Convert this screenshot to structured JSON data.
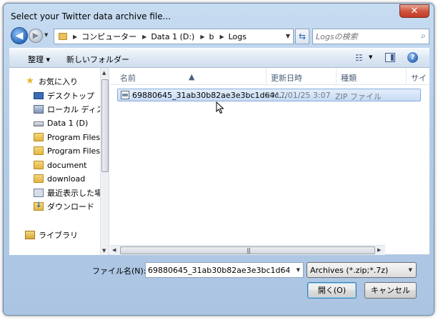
{
  "window": {
    "title": "Select your Twitter data archive file...",
    "close_glyph": "✕"
  },
  "address": {
    "back_glyph": "◀",
    "forward_glyph": "▶",
    "breadcrumbs": [
      "コンピューター",
      "Data 1 (D:)",
      "b",
      "Logs"
    ],
    "refresh_glyph": "⇆"
  },
  "search": {
    "placeholder": "Logsの検索",
    "icon": "search-icon"
  },
  "commandbar": {
    "organize_label": "整理 ▾",
    "newfolder_label": "新しいフォルダー",
    "view_glyph": "☷",
    "help_glyph": "?"
  },
  "nav": {
    "items": [
      {
        "label": "お気に入り",
        "icon": "star-icon"
      },
      {
        "label": "デスクトップ",
        "icon": "desktop-icon"
      },
      {
        "label": "ローカル ディス",
        "icon": "local-disk-icon"
      },
      {
        "label": "Data 1 (D)",
        "icon": "drive-icon"
      },
      {
        "label": "Program Files",
        "icon": "folder-icon"
      },
      {
        "label": "Program Files (",
        "icon": "folder-icon"
      },
      {
        "label": "document",
        "icon": "folder-icon"
      },
      {
        "label": "download",
        "icon": "folder-icon"
      },
      {
        "label": "最近表示した場所",
        "icon": "recent-icon"
      },
      {
        "label": "ダウンロード",
        "icon": "downloads-icon"
      },
      {
        "label": "ライブラリ",
        "icon": "library-icon"
      }
    ]
  },
  "columns": {
    "name": "名前",
    "modified": "更新日時",
    "type": "種類",
    "size": "サイ"
  },
  "files": [
    {
      "name": "69880645_31ab30b82ae3e3bc1d64c...",
      "modified": "2017/01/25 3:07",
      "type": "ZIP ファイル"
    }
  ],
  "bottom": {
    "filename_label": "ファイル名(N):",
    "filename_value": "69880645_31ab30b82ae3e3bc1d64cd0116",
    "filter_value": "Archives (*.zip;*.7z)",
    "open_label": "開く(O)",
    "cancel_label": "キャンセル"
  },
  "colors": {
    "accent": "#2a6cc0",
    "selection": "#c7dbf5",
    "chrome": "#b5cde8"
  }
}
